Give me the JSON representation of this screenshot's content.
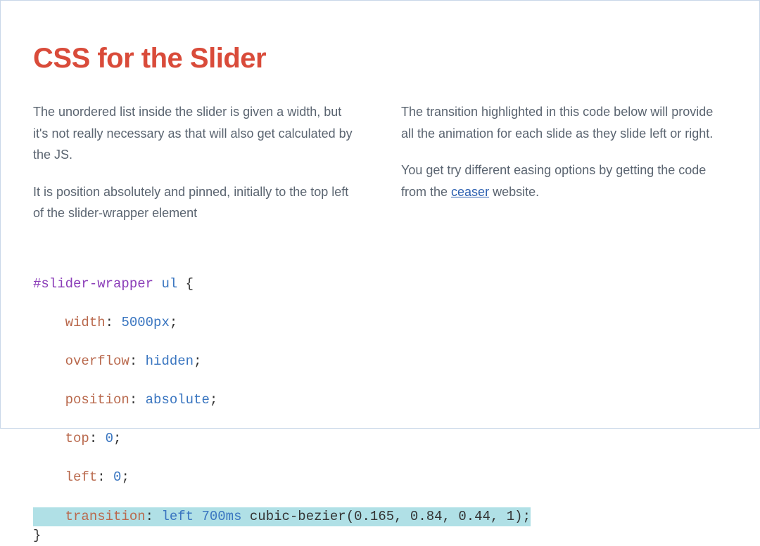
{
  "title": "CSS for the Slider",
  "left": {
    "p1": "The unordered list inside the slider is given a width, but it's not really necessary as that will also get calculated by the JS.",
    "p2": "It is position absolutely and pinned, initially to the top left of the slider-wrapper element"
  },
  "right": {
    "p1": "The transition highlighted in this code below will provide all the animation for each slide as they slide left or right.",
    "p2a": "You get try different easing options by getting the code from the ",
    "link": "ceaser",
    "p2b": " website."
  },
  "code": {
    "selector_id": "#slider-wrapper",
    "selector_tag": "ul",
    "open_brace": "{",
    "rules": [
      {
        "prop": "width",
        "value": "5000px",
        "value_class": "tok-num"
      },
      {
        "prop": "overflow",
        "value": "hidden",
        "value_class": "tok-val"
      },
      {
        "prop": "position",
        "value": "absolute",
        "value_class": "tok-val"
      },
      {
        "prop": "top",
        "value": "0",
        "value_class": "tok-num"
      },
      {
        "prop": "left",
        "value": "0",
        "value_class": "tok-num"
      }
    ],
    "hl": {
      "prop": "transition",
      "val1": "left",
      "val2": "700ms",
      "func": "cubic-bezier(0.165, 0.84, 0.44, 1)"
    },
    "close_brace": "}"
  }
}
